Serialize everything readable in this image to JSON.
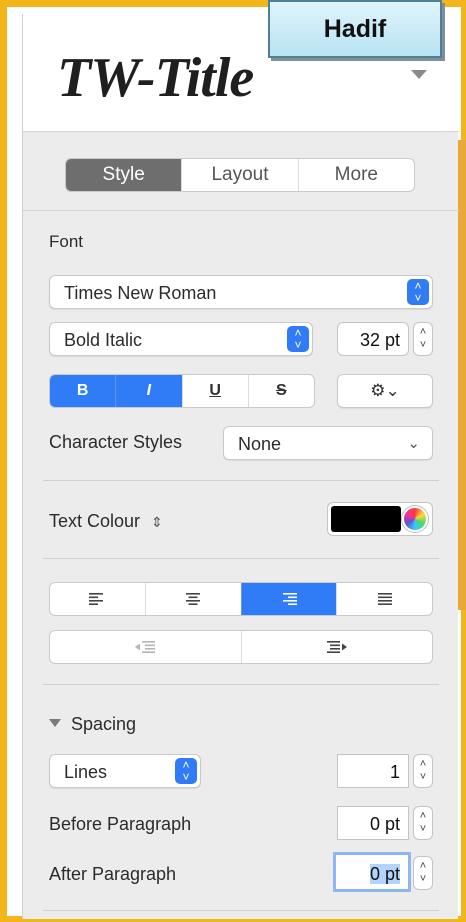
{
  "badge": {
    "text": "Hadif"
  },
  "style_name": {
    "text": "TW-Title",
    "icon": "chevron-down-icon"
  },
  "tabs": [
    {
      "label": "Style",
      "active": true
    },
    {
      "label": "Layout",
      "active": false
    },
    {
      "label": "More",
      "active": false
    }
  ],
  "font": {
    "section_label": "Font",
    "family": "Times New Roman",
    "typeface": "Bold Italic",
    "size": "32 pt",
    "format_buttons": [
      {
        "label": "B",
        "active": true,
        "icon": "bold-icon"
      },
      {
        "label": "I",
        "active": true,
        "icon": "italic-icon"
      },
      {
        "label": "U",
        "active": false,
        "icon": "underline-icon"
      },
      {
        "label": "S",
        "active": false,
        "icon": "strikethrough-icon"
      }
    ],
    "gear_label": "⚙⌄",
    "character_styles_label": "Character Styles",
    "character_styles_value": "None"
  },
  "text_colour": {
    "label": "Text Colour",
    "value": "#000000"
  },
  "alignment": {
    "options": [
      {
        "name": "align-left",
        "active": false
      },
      {
        "name": "align-center",
        "active": false
      },
      {
        "name": "align-right",
        "active": true
      },
      {
        "name": "align-justify",
        "active": false
      }
    ],
    "indent": [
      "decrease-indent",
      "increase-indent"
    ]
  },
  "spacing": {
    "section_label": "Spacing",
    "mode": "Lines",
    "line_value": "1",
    "before_label": "Before Paragraph",
    "before_value": "0 pt",
    "after_label": "After Paragraph",
    "after_value_selected": "0",
    "after_value_unit": " pt"
  },
  "colors": {
    "accent": "#2f7cf6",
    "frame": "#f2b61c"
  }
}
